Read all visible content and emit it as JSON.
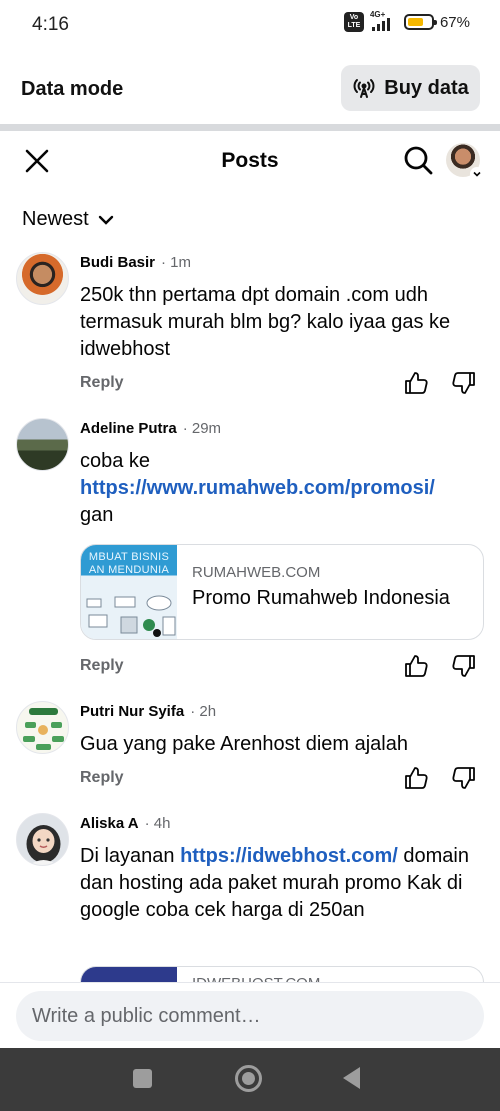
{
  "status": {
    "time": "4:16",
    "network": "4G+",
    "volte": "Vo LTE",
    "battery_pct": "67%",
    "battery_level": 0.67
  },
  "data_bar": {
    "label": "Data mode",
    "buy_button": "Buy data"
  },
  "header": {
    "title": "Posts"
  },
  "sort": {
    "label": "Newest"
  },
  "comments": [
    {
      "name": "Budi Basir",
      "time": "· 1m",
      "text": "250k thn pertama dpt domain .com udh termasuk murah blm bg? kalo iyaa gas ke idwebhost",
      "reply": "Reply"
    },
    {
      "name": "Adeline Putra",
      "time": "· 29m",
      "text_before": "coba ke",
      "link": "https://www.rumahweb.com/promosi/",
      "text_after": "gan",
      "reply": "Reply",
      "card": {
        "thumb_text": "MBUAT BISNIS AN MENDUNIA",
        "domain": "RUMAHWEB.COM",
        "title": "Promo Rumahweb Indonesia"
      }
    },
    {
      "name": "Putri Nur Syifa",
      "time": "· 2h",
      "text": "Gua yang pake Arenhost diem ajalah",
      "reply": "Reply"
    },
    {
      "name": "Aliska A",
      "time": "· 4h",
      "text_before": "Di layanan ",
      "link": "https://idwebhost.com/",
      "text_after": " domain dan hosting ada paket murah promo Kak di google coba cek harga di 250an",
      "card": {
        "domain": "IDWEBHOST.COM"
      }
    }
  ],
  "composer": {
    "placeholder": "Write a public comment…"
  },
  "icons": [
    "close-icon",
    "search-icon",
    "chevron-down-icon",
    "thumbs-up-icon",
    "thumbs-down-icon",
    "broadcast-icon",
    "nav-recents-icon",
    "nav-home-icon",
    "nav-back-icon"
  ],
  "colors": {
    "link": "#1f5fbf",
    "battery": "#f6b800",
    "secondary_text": "#65676b",
    "nav_bar": "#3b3b3b"
  }
}
